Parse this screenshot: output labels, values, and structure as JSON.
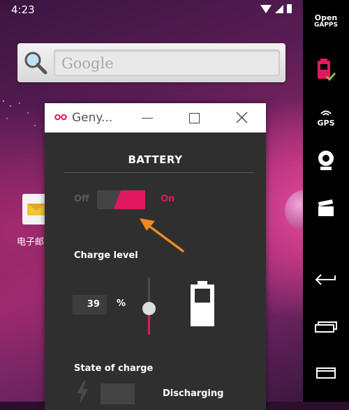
{
  "status_bar": {
    "time": "4:23"
  },
  "search_widget": {
    "placeholder": "Google"
  },
  "home_apps": [
    {
      "label": "电子邮"
    }
  ],
  "geny_window": {
    "title": "Geny...",
    "panel": {
      "title": "BATTERY",
      "toggle": {
        "off_label": "Off",
        "on_label": "On",
        "state": "on"
      },
      "charge_level": {
        "label": "Charge level",
        "value": "39",
        "unit": "%",
        "slider_fraction": 0.39
      },
      "state_of_charge": {
        "label": "State of charge",
        "value": "Discharging"
      }
    }
  },
  "toolbar": {
    "items": [
      {
        "name": "opengapps",
        "line1": "Open",
        "line2": "GAPPS"
      },
      {
        "name": "battery-icon"
      },
      {
        "name": "gps",
        "label": "GPS"
      },
      {
        "name": "webcam-icon"
      },
      {
        "name": "screencast-icon"
      },
      {
        "name": "back-icon"
      },
      {
        "name": "recent-apps-icon"
      },
      {
        "name": "menu-icon"
      }
    ]
  },
  "colors": {
    "accent": "#e0185f",
    "panel_bg": "#2f2f2f",
    "annotation_arrow": "#f08a1e"
  }
}
